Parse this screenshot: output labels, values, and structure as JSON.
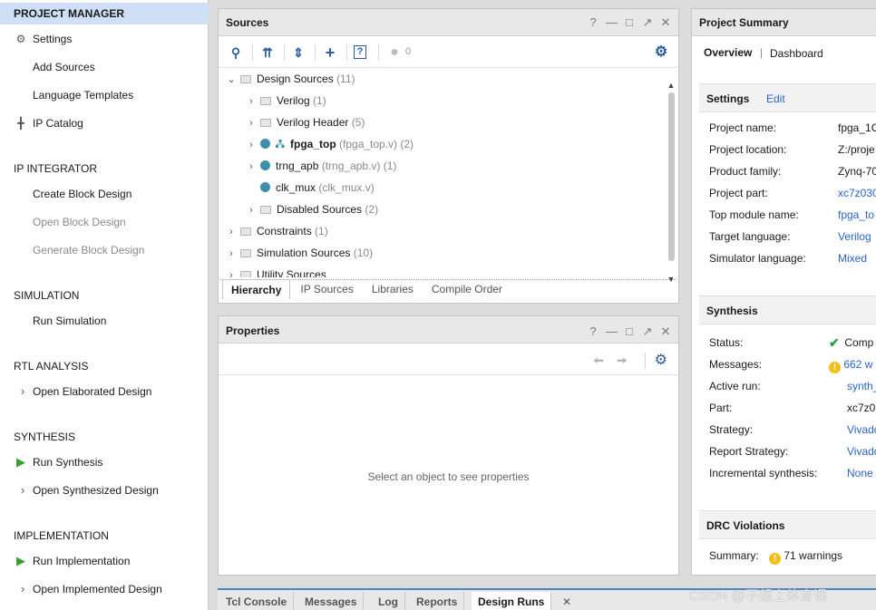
{
  "flow_navigator": {
    "project_manager": "PROJECT MANAGER",
    "settings": "Settings",
    "add_sources": "Add Sources",
    "language_templates": "Language Templates",
    "ip_catalog": "IP Catalog",
    "ip_integrator": "IP INTEGRATOR",
    "create_block_design": "Create Block Design",
    "open_block_design": "Open Block Design",
    "generate_block_design": "Generate Block Design",
    "simulation": "SIMULATION",
    "run_simulation": "Run Simulation",
    "rtl_analysis": "RTL ANALYSIS",
    "open_elaborated_design": "Open Elaborated Design",
    "synthesis": "SYNTHESIS",
    "run_synthesis": "Run Synthesis",
    "open_synthesized_design": "Open Synthesized Design",
    "implementation": "IMPLEMENTATION",
    "run_implementation": "Run Implementation",
    "open_implemented_design": "Open Implemented Design"
  },
  "sources": {
    "title": "Sources",
    "badge_count": "0",
    "tree": {
      "design_sources": "Design Sources",
      "design_sources_count": "(11)",
      "verilog": "Verilog",
      "verilog_count": "(1)",
      "verilog_header": "Verilog Header",
      "verilog_header_count": "(5)",
      "fpga_top": "fpga_top",
      "fpga_top_detail": "(fpga_top.v) (2)",
      "trng_apb": "trng_apb",
      "trng_apb_detail": "(trng_apb.v) (1)",
      "clk_mux": "clk_mux",
      "clk_mux_detail": "(clk_mux.v)",
      "disabled_sources": "Disabled Sources",
      "disabled_sources_count": "(2)",
      "constraints": "Constraints",
      "constraints_count": "(1)",
      "simulation_sources": "Simulation Sources",
      "simulation_sources_count": "(10)",
      "utility_sources": "Utility Sources"
    },
    "tabs": [
      "Hierarchy",
      "IP Sources",
      "Libraries",
      "Compile Order"
    ]
  },
  "properties": {
    "title": "Properties",
    "empty_message": "Select an object to see properties"
  },
  "project_summary": {
    "title": "Project Summary",
    "tab_overview": "Overview",
    "tab_separator": "|",
    "tab_dashboard": "Dashboard",
    "settings_title": "Settings",
    "settings_edit": "Edit",
    "project_name_label": "Project name:",
    "project_name_value": "fpga_1C",
    "project_location_label": "Project location:",
    "project_location_value": "Z:/proje",
    "product_family_label": "Product family:",
    "product_family_value": "Zynq-70",
    "project_part_label": "Project part:",
    "project_part_value": "xc7z030",
    "top_module_label": "Top module name:",
    "top_module_value": "fpga_to",
    "target_language_label": "Target language:",
    "target_language_value": "Verilog",
    "simulator_language_label": "Simulator language:",
    "simulator_language_value": "Mixed",
    "synthesis_title": "Synthesis",
    "status_label": "Status:",
    "status_value": "Comp",
    "messages_label": "Messages:",
    "messages_value": "662 w",
    "active_run_label": "Active run:",
    "active_run_value": "synth_",
    "part_label": "Part:",
    "part_value": "xc7z03",
    "strategy_label": "Strategy:",
    "strategy_value": "Vivado",
    "report_strategy_label": "Report Strategy:",
    "report_strategy_value": "Vivado",
    "incremental_label": "Incremental synthesis:",
    "incremental_value": "None",
    "drc_title": "DRC Violations",
    "summary_label": "Summary:",
    "summary_value": "71 warnings"
  },
  "console_tabs": [
    "Tcl Console",
    "Messages",
    "Log",
    "Reports",
    "Design Runs"
  ],
  "watermark": "CSDN @不想上体育课",
  "colors": {
    "accent": "#4c84c5",
    "active_section": "#cfdff5",
    "link": "#2a64c4",
    "run_icon": "#34a030",
    "warning": "#f5bf1a"
  }
}
